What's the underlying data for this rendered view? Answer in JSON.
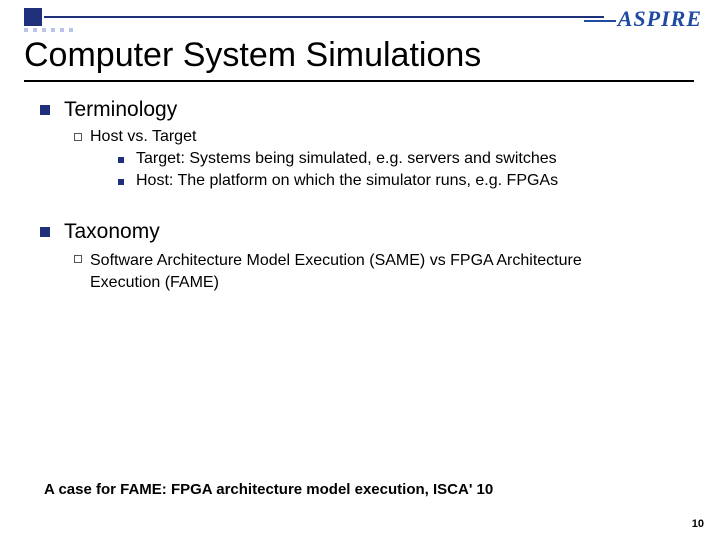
{
  "logo": {
    "text": "SPIRE"
  },
  "title": "Computer System Simulations",
  "sections": [
    {
      "heading": "Terminology",
      "sub": [
        {
          "label": "Host vs. Target",
          "items": [
            "Target: Systems being simulated, e.g. servers and switches",
            "Host: The platform on which the simulator runs, e.g. FPGAs"
          ]
        }
      ]
    },
    {
      "heading": "Taxonomy",
      "sub": [
        {
          "label": "Software Architecture Model Execution (SAME) vs FPGA Architecture Execution (FAME)"
        }
      ]
    }
  ],
  "footnote": "A case for FAME: FPGA architecture model execution, ISCA' 10",
  "page_number": "10"
}
